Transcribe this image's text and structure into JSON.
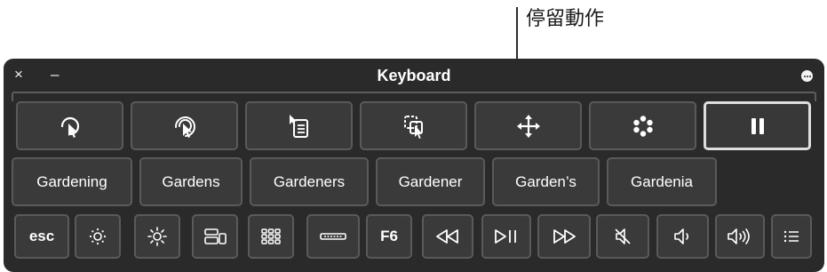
{
  "callout": {
    "label": "停留動作"
  },
  "window": {
    "title": "Keyboard",
    "close_glyph": "×",
    "minimize_glyph": "–"
  },
  "dwell_actions": [
    {
      "name": "left-click",
      "icon": "pointer-click-icon"
    },
    {
      "name": "double-click",
      "icon": "pointer-double-click-icon"
    },
    {
      "name": "right-click",
      "icon": "context-menu-icon"
    },
    {
      "name": "drag-and-drop",
      "icon": "drag-icon"
    },
    {
      "name": "scroll",
      "icon": "move-arrows-icon"
    },
    {
      "name": "options",
      "icon": "dot-ring-icon"
    },
    {
      "name": "pause",
      "icon": "pause-icon",
      "selected": true
    }
  ],
  "suggestions": [
    "Gardening",
    "Gardens",
    "Gardeners",
    "Gardener",
    "Garden’s",
    "Gardenia"
  ],
  "function_row": {
    "esc_label": "esc",
    "f6_label": "F6",
    "icons": [
      "brightness-down-icon",
      "brightness-up-icon",
      "mission-control-icon",
      "launchpad-icon",
      "keyboard-illumination-icon",
      "rewind-icon",
      "play-pause-icon",
      "fast-forward-icon",
      "mute-icon",
      "volume-down-icon",
      "volume-up-icon",
      "list-icon"
    ]
  },
  "colors": {
    "panel": "#2a2a2a",
    "key": "#3a3a3a",
    "key_border": "#5a5a5a",
    "selected_border": "#dedede",
    "text": "#ffffff"
  }
}
